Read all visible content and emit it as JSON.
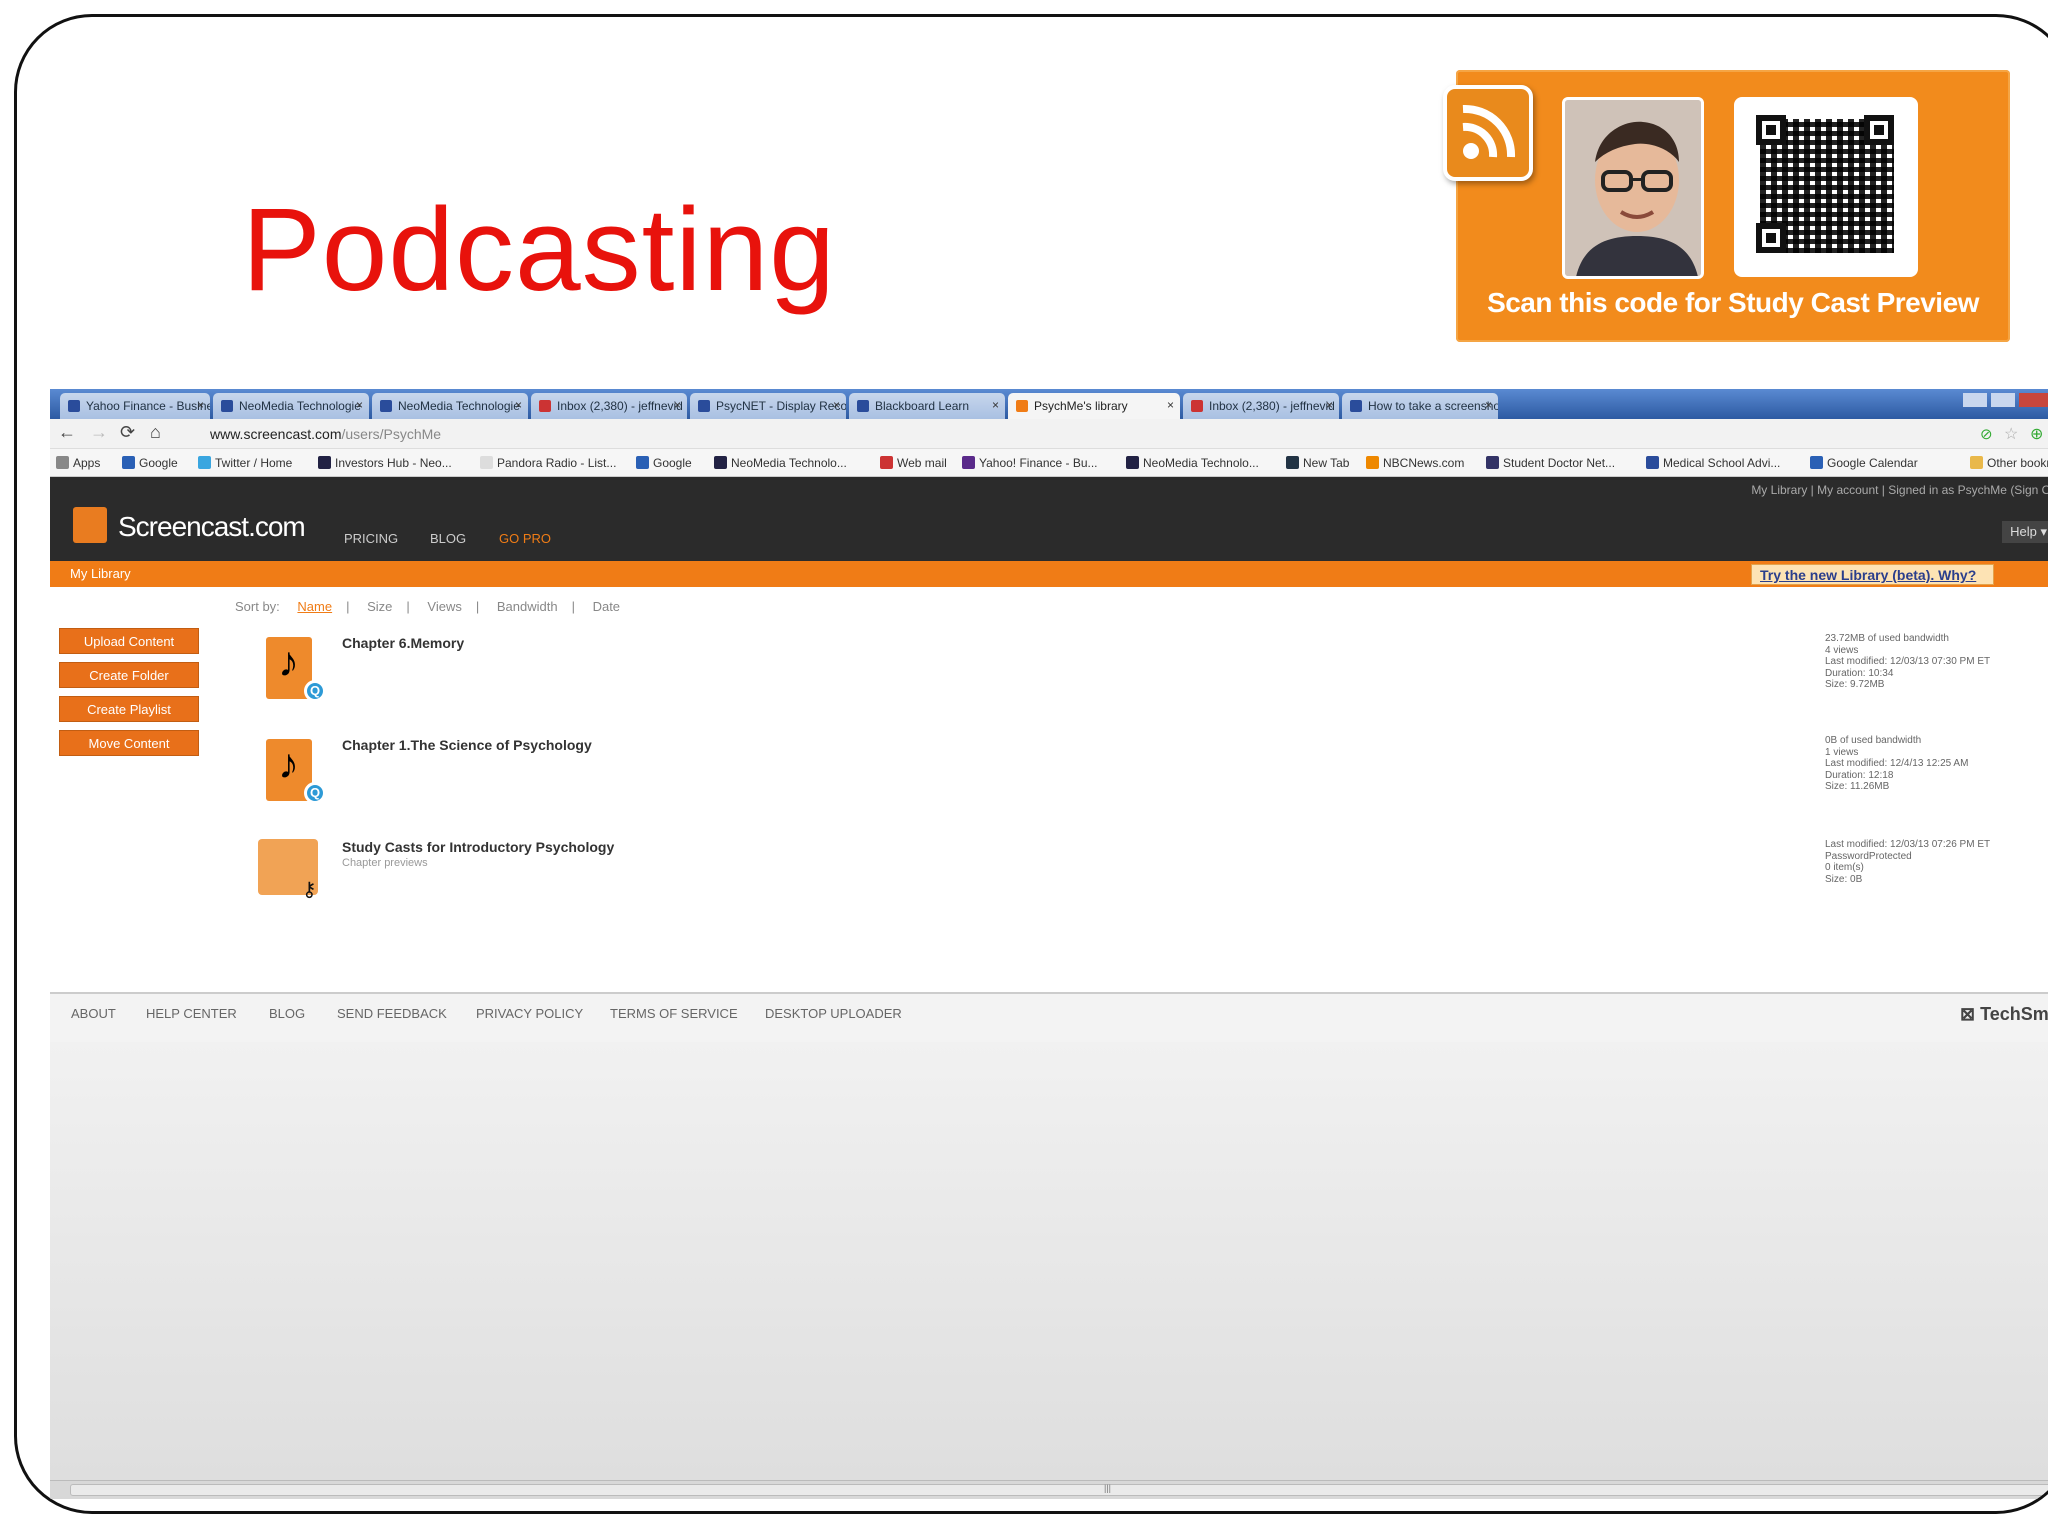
{
  "slide": {
    "title": "Podcasting",
    "promo_caption": "Scan this code for Study Cast Preview"
  },
  "browser": {
    "tabs": [
      {
        "label": "Yahoo Finance - Busines"
      },
      {
        "label": "NeoMedia Technologie"
      },
      {
        "label": "NeoMedia Technologie"
      },
      {
        "label": "Inbox (2,380) - jeffnevid"
      },
      {
        "label": "PsycNET - Display Record"
      },
      {
        "label": "Blackboard Learn"
      },
      {
        "label": "PsychMe's library"
      },
      {
        "label": "Inbox (2,380) - jeffnevid"
      },
      {
        "label": "How to take a screenshot"
      }
    ],
    "url_host": "www.screencast.com",
    "url_path": "/users/PsychMe",
    "bookmarks": [
      "Apps",
      "Google",
      "Twitter / Home",
      "Investors Hub - Neo...",
      "Pandora Radio - List...",
      "Google",
      "NeoMedia Technolo...",
      "Web mail",
      "Yahoo! Finance - Bu...",
      "NeoMedia Technolo...",
      "New Tab",
      "NBCNews.com",
      "Student Doctor Net...",
      "Medical School Advi...",
      "Google Calendar",
      "Other bookm"
    ]
  },
  "site": {
    "logo": "Screencast.com",
    "nav": [
      "PRICING",
      "BLOG",
      "GO PRO"
    ],
    "account_links": "My Library | My account | Signed in as PsychMe (Sign Out)",
    "help": "Help",
    "my_library": "My Library",
    "new_library": "Try the new Library (beta). Why?",
    "sort_label": "Sort by:",
    "sort_options": [
      "Name",
      "Size",
      "Views",
      "Bandwidth",
      "Date"
    ],
    "side_buttons": [
      "Upload Content",
      "Create Folder",
      "Create Playlist",
      "Move Content"
    ],
    "items": [
      {
        "title": "Chapter 6.Memory",
        "subtitle": "",
        "meta": [
          "23.72MB of used bandwidth",
          "4 views",
          "Last modified: 12/03/13 07:30 PM ET",
          "Duration: 10:34",
          "Size: 9.72MB"
        ]
      },
      {
        "title": "Chapter 1.The Science of Psychology",
        "subtitle": "",
        "meta": [
          "0B of used bandwidth",
          "1 views",
          "Last modified: 12/4/13 12:25 AM",
          "Duration: 12:18",
          "Size: 11.26MB"
        ]
      },
      {
        "title": "Study Casts for Introductory Psychology",
        "subtitle": "Chapter previews",
        "meta": [
          "Last modified: 12/03/13 07:26 PM ET",
          "PasswordProtected",
          "0 item(s)",
          "Size: 0B"
        ]
      }
    ],
    "footer_links": [
      "ABOUT",
      "HELP CENTER",
      "BLOG",
      "SEND FEEDBACK",
      "PRIVACY POLICY",
      "TERMS OF SERVICE",
      "DESKTOP UPLOADER"
    ],
    "footer_brand": "TechSmit"
  },
  "icons": [
    "rss-icon",
    "qr-code-icon",
    "music-note-icon",
    "quicktime-icon",
    "folder-icon",
    "key-icon"
  ],
  "colors": {
    "title": "#e8120c",
    "promo": "#f28b1c",
    "site_orange": "#f07c16",
    "site_header": "#2b2b2b"
  }
}
